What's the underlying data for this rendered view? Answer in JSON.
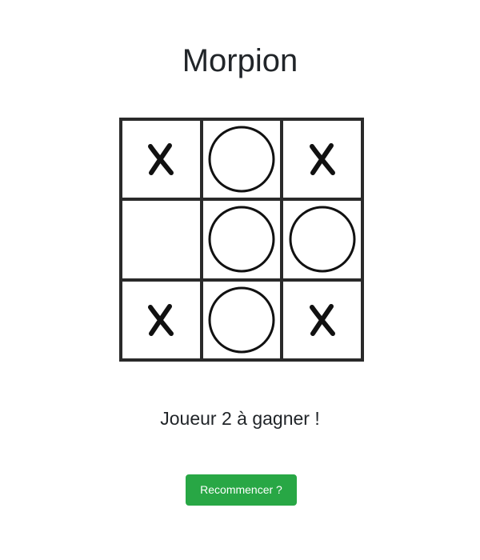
{
  "game": {
    "title": "Morpion",
    "board": [
      [
        "X",
        "O",
        "X"
      ],
      [
        "",
        "O",
        "O"
      ],
      [
        "X",
        "O",
        "X"
      ]
    ],
    "message": "Joueur 2 à gagner !",
    "restart_label": "Recommencer ?"
  },
  "colors": {
    "grid_line": "#2a2a2a",
    "mark": "#111111",
    "button_bg": "#28a745",
    "button_text": "#ffffff",
    "text": "#212529"
  },
  "icons": {
    "X": "cross-mark-icon",
    "O": "circle-mark-icon"
  }
}
